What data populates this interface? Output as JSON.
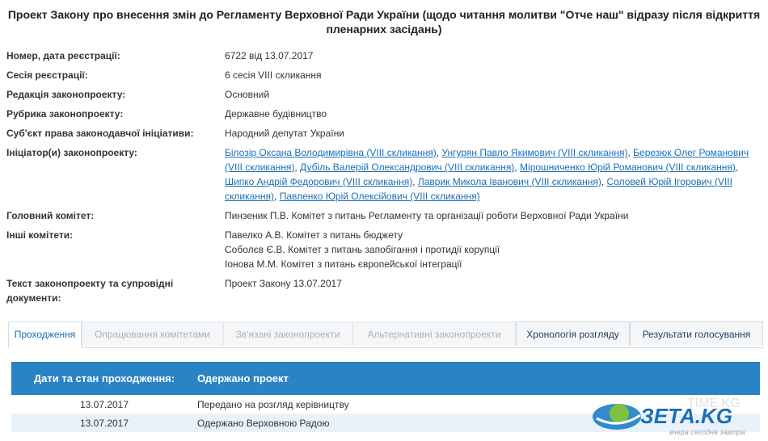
{
  "title": "Проект Закону про внесення змін до Регламенту Верховної Ради України (щодо читання молитви \"Отче наш\" відразу після відкриття пленарних засідань)",
  "info": {
    "reg_label": "Номер, дата реєстрації:",
    "reg_value": "6722 від 13.07.2017",
    "session_label": "Сесія реєстрації:",
    "session_value": "6 сесія VIII скликання",
    "edition_label": "Редакція законопроекту:",
    "edition_value": "Основний",
    "rubric_label": "Рубрика законопроекту:",
    "rubric_value": "Державне будівництво",
    "subject_label": "Суб'єкт права законодавчої ініціативи:",
    "subject_value": "Народний депутат України",
    "initiators_label": "Ініціатор(и) законопроекту:",
    "initiators": [
      "Білозір Оксана Володимирівна (VIII скликання)",
      "Унгурян Павло Якимович (VIII скликання)",
      "Березюк Олег Романович (VIII скликання)",
      "Дубіль Валерій Олександрович (VIII скликання)",
      "Мірошниченко Юрій Романович (VIII скликання)",
      "Шипко Андрій Федорович (VIII скликання)",
      "Лаврик Микола Іванович (VIII скликання)",
      "Соловей Юрій Ігорович (VIII скликання)",
      "Павленко Юрій Олексійович (VIII скликання)"
    ],
    "main_committee_label": "Головний комітет:",
    "main_committee_value": "Пинзеник П.В. Комітет з питань Регламенту та організації роботи Верховної Ради України",
    "other_committees_label": "Інші комітети:",
    "other_committees": [
      "Павелко А.В. Комітет з питань бюджету",
      "Соболєв Є.В. Комітет з питань запобігання і протидії корупції",
      "Іонова М.М. Комітет з питань європейської інтеграції"
    ],
    "docs_label": "Текст законопроекту та супровідні документи:",
    "docs_value": "Проект Закону 13.07.2017"
  },
  "tabs": [
    "Проходження",
    "Опрацювання комітетами",
    "Зв'язані законопроекти",
    "Альтернативні законопроекти",
    "Хронологія розгляду",
    "Результати голосування"
  ],
  "table": {
    "header_date": "Дати та стан проходження:",
    "header_status": "Одержано проект",
    "rows": [
      {
        "date": "13.07.2017",
        "status": "Передано на розгляд керівництву"
      },
      {
        "date": "13.07.2017",
        "status": "Одержано Верховною Радою"
      }
    ]
  },
  "logo": {
    "text": "ЗЕТА.KG",
    "watermark": "TIME.KG",
    "slogan": "вчера сегодня завтра"
  },
  "colors": {
    "link": "#1a6fb5",
    "header_blue": "#2a83c4",
    "row_alt": "#e9f2fb"
  }
}
